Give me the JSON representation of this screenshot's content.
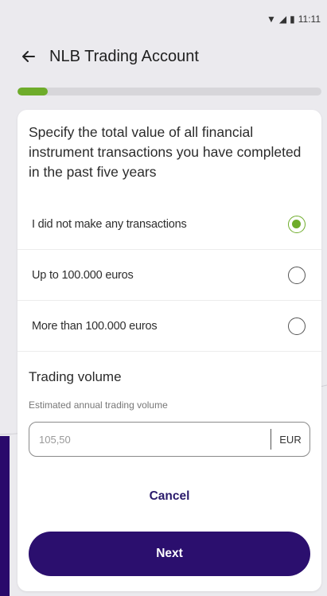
{
  "status_bar": {
    "time": "11:11",
    "icons": [
      "wifi-icon",
      "signal-icon",
      "battery-icon"
    ]
  },
  "app_bar": {
    "title": "NLB Trading Account",
    "back_icon": "arrow-left-icon"
  },
  "progress": {
    "fraction": 0.1,
    "accent": "#6eac2a"
  },
  "question": "Specify the total value of all financial instrument transactions you have completed in the past five years",
  "options": [
    {
      "label": "I did not make any transactions",
      "selected": true
    },
    {
      "label": "Up to 100.000 euros",
      "selected": false
    },
    {
      "label": "More than 100.000 euros",
      "selected": false
    }
  ],
  "trading_volume": {
    "title": "Trading volume",
    "field_label": "Estimated annual trading volume",
    "value": "105,50",
    "unit": "EUR"
  },
  "actions": {
    "cancel_label": "Cancel",
    "next_label": "Next"
  },
  "colors": {
    "primary": "#2b0f6e",
    "accent": "#6eac2a",
    "background": "#ebeaee"
  }
}
